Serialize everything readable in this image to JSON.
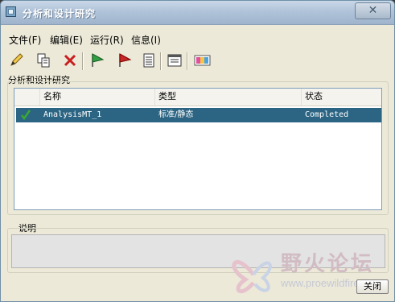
{
  "window": {
    "title": "分析和设计研究"
  },
  "menu": [
    {
      "label": "文件(F)"
    },
    {
      "label": "编辑(E)"
    },
    {
      "label": "运行(R)"
    },
    {
      "label": "信息(I)"
    }
  ],
  "toolbar_icons": [
    "pencil-icon",
    "copy-icon",
    "delete-icon",
    "green-flag-icon",
    "red-flag-icon",
    "list-icon",
    "info-window-icon",
    "chart-icon"
  ],
  "studies": {
    "group_label": "分析和设计研究",
    "columns": [
      "名称",
      "类型",
      "状态"
    ],
    "rows": [
      {
        "name": "AnalysisMT_1",
        "type": "标准/静态",
        "status": "Completed",
        "selected": true
      }
    ]
  },
  "description": {
    "label": "说明",
    "value": ""
  },
  "buttons": {
    "close": "关闭"
  },
  "watermark": {
    "text": "野火论坛",
    "url": "www.proewildfire.cn"
  },
  "colors": {
    "selected_row": "#2c6583",
    "check": "#3aa832",
    "window_bg": "#ece9d8"
  }
}
